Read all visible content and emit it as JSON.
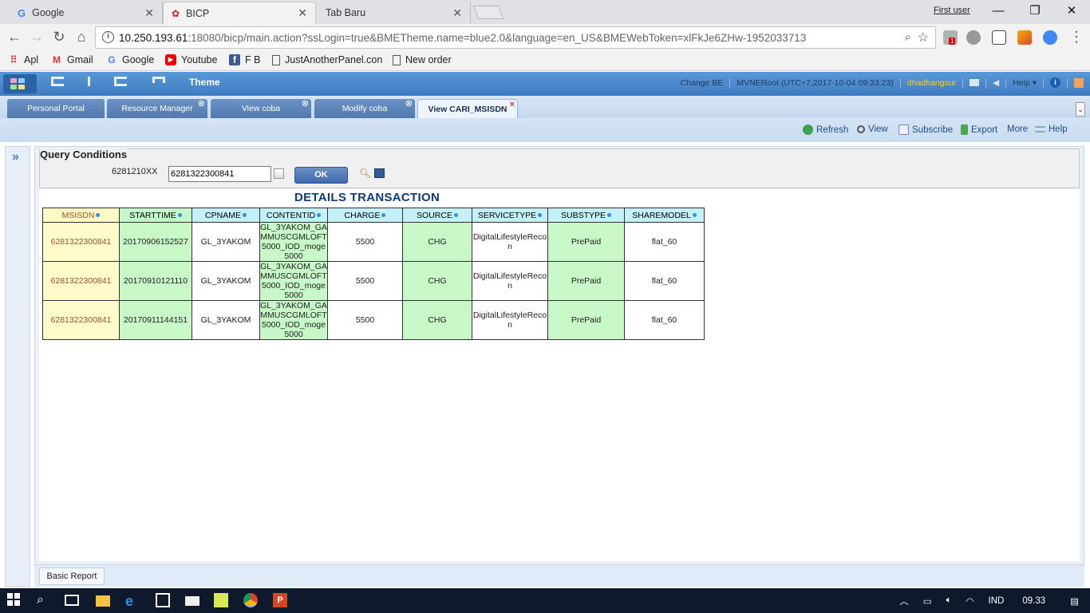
{
  "browser": {
    "tabs": [
      {
        "title": "Google",
        "favicon": "google-g-icon"
      },
      {
        "title": "BICP",
        "favicon": "huawei-icon"
      },
      {
        "title": "Tab Baru",
        "favicon": ""
      }
    ],
    "profile_label": "First user",
    "url_host": "10.250.193.61",
    "url_rest": ":18080/bicp/main.action?ssLogin=true&BMETheme.name=blue2.0&language=en_US&BMEWebToken=xlFkJe6ZHw-1952033713",
    "extension_badge": "1",
    "bookmarks": [
      "Apl",
      "Gmail",
      "Google",
      "Youtube",
      "F B",
      "JustAnotherPanel.con",
      "New order"
    ]
  },
  "app": {
    "theme_label": "Theme",
    "change_be": "Change BE",
    "session_info": "MVNERoot (UTC+7,2017-10-04 09:33:23)",
    "username": "dhadhangsur",
    "help_label": "Help",
    "tabs": [
      "Personal Portal",
      "Resource Manager",
      "View coba",
      "Modify coba",
      "View CARI_MSISDN"
    ],
    "actions": [
      "Refresh",
      "View",
      "Subscribe",
      "Export",
      "More",
      "Help"
    ]
  },
  "query": {
    "title": "Query Conditions",
    "label": "6281210XX",
    "value": "6281322300841",
    "ok_label": "OK"
  },
  "report": {
    "title": "DETAILS TRANSACTION",
    "columns": [
      "MSISDN",
      "STARTTIME",
      "CPNAME",
      "CONTENTID",
      "CHARGE",
      "SOURCE",
      "SERVICETYPE",
      "SUBSTYPE",
      "SHAREMODEL"
    ],
    "rows": [
      [
        "6281322300841",
        "20170906152527",
        "GL_3YAKOM",
        "GL_3YAKOM_GAMMUSCGMLOFT5000_IOD_moge5000",
        "5500",
        "CHG",
        "DigitalLifestyleRecon",
        "PrePaid",
        "flat_60"
      ],
      [
        "6281322300841",
        "20170910121110",
        "GL_3YAKOM",
        "GL_3YAKOM_GAMMUSCGMLOFT5000_IOD_moge5000",
        "5500",
        "CHG",
        "DigitalLifestyleRecon",
        "PrePaid",
        "flat_60"
      ],
      [
        "6281322300841",
        "20170911144151",
        "GL_3YAKOM",
        "GL_3YAKOM_GAMMUSCGMLOFT5000_IOD_moge5000",
        "5500",
        "CHG",
        "DigitalLifestyleRecon",
        "PrePaid",
        "flat_60"
      ]
    ],
    "bottom_tab": "Basic Report"
  },
  "taskbar": {
    "language": "IND",
    "time": "09.33"
  }
}
